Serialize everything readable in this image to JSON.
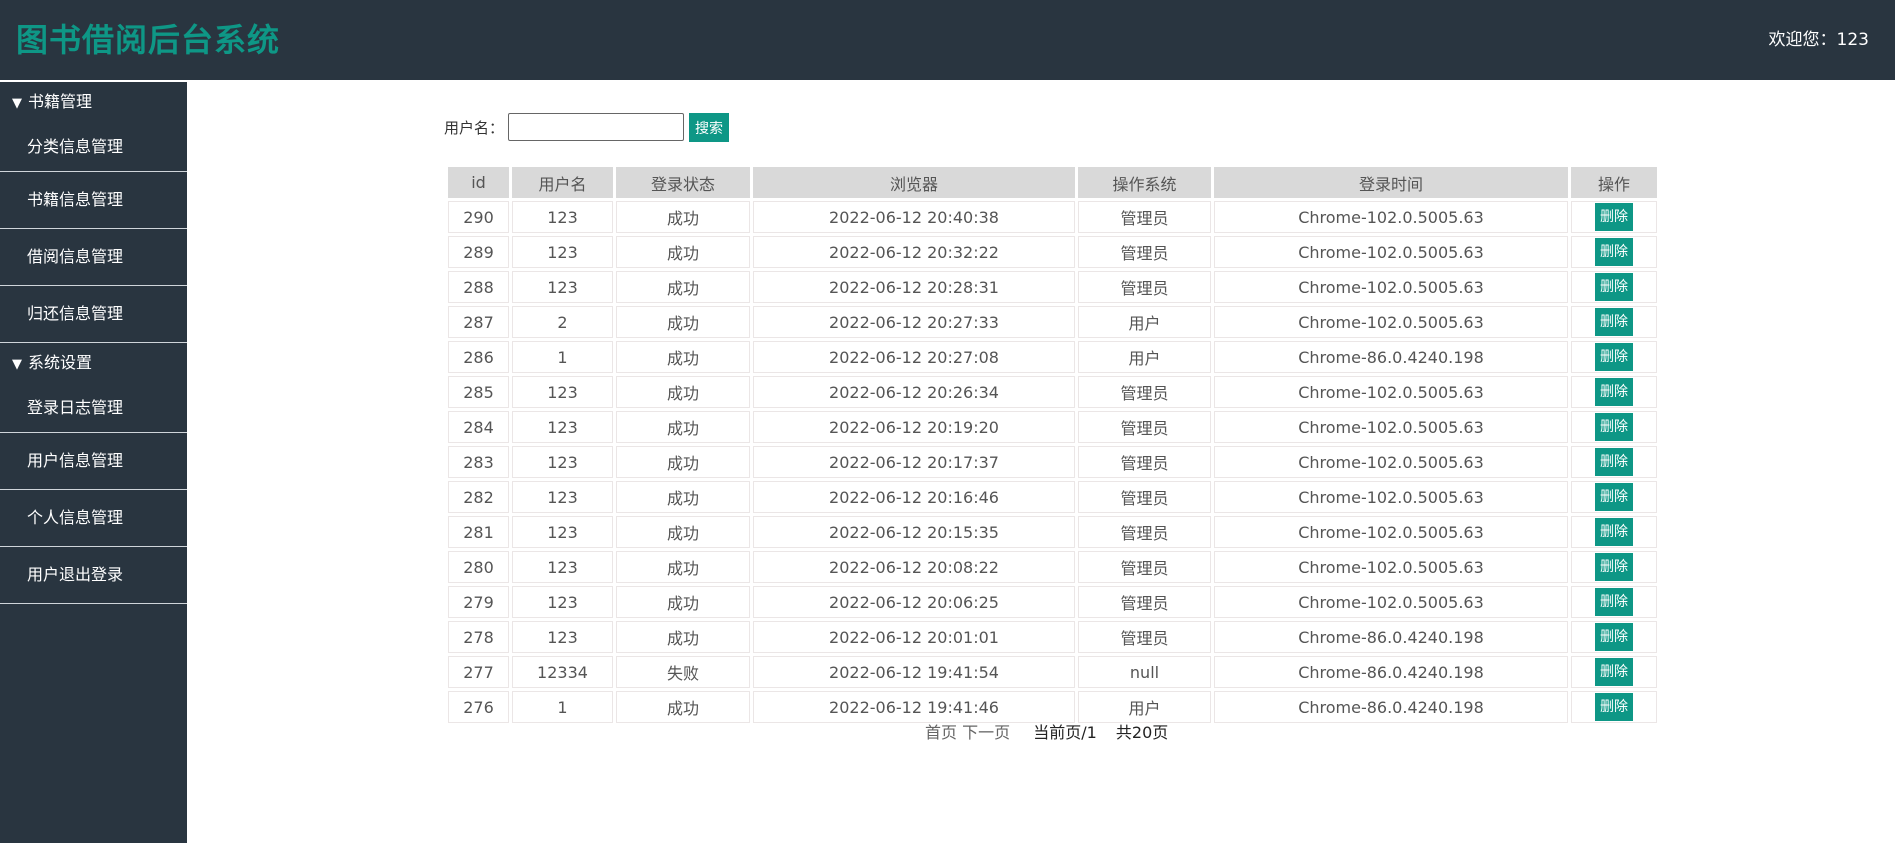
{
  "header": {
    "title": "图书借阅后台系统",
    "welcome": "欢迎您：123"
  },
  "sidebar": {
    "groups": [
      {
        "label": "书籍管理",
        "items": [
          "分类信息管理",
          "书籍信息管理",
          "借阅信息管理",
          "归还信息管理"
        ]
      },
      {
        "label": "系统设置",
        "items": [
          "登录日志管理",
          "用户信息管理",
          "个人信息管理",
          "用户退出登录"
        ]
      }
    ]
  },
  "search": {
    "label": "用户名：",
    "value": "",
    "button": "搜索"
  },
  "table": {
    "headers": [
      "id",
      "用户名",
      "登录状态",
      "浏览器",
      "操作系统",
      "登录时间",
      "操作"
    ],
    "action_label": "删除",
    "rows": [
      [
        "290",
        "123",
        "成功",
        "2022-06-12 20:40:38",
        "管理员",
        "Chrome-102.0.5005.63"
      ],
      [
        "289",
        "123",
        "成功",
        "2022-06-12 20:32:22",
        "管理员",
        "Chrome-102.0.5005.63"
      ],
      [
        "288",
        "123",
        "成功",
        "2022-06-12 20:28:31",
        "管理员",
        "Chrome-102.0.5005.63"
      ],
      [
        "287",
        "2",
        "成功",
        "2022-06-12 20:27:33",
        "用户",
        "Chrome-102.0.5005.63"
      ],
      [
        "286",
        "1",
        "成功",
        "2022-06-12 20:27:08",
        "用户",
        "Chrome-86.0.4240.198"
      ],
      [
        "285",
        "123",
        "成功",
        "2022-06-12 20:26:34",
        "管理员",
        "Chrome-102.0.5005.63"
      ],
      [
        "284",
        "123",
        "成功",
        "2022-06-12 20:19:20",
        "管理员",
        "Chrome-102.0.5005.63"
      ],
      [
        "283",
        "123",
        "成功",
        "2022-06-12 20:17:37",
        "管理员",
        "Chrome-102.0.5005.63"
      ],
      [
        "282",
        "123",
        "成功",
        "2022-06-12 20:16:46",
        "管理员",
        "Chrome-102.0.5005.63"
      ],
      [
        "281",
        "123",
        "成功",
        "2022-06-12 20:15:35",
        "管理员",
        "Chrome-102.0.5005.63"
      ],
      [
        "280",
        "123",
        "成功",
        "2022-06-12 20:08:22",
        "管理员",
        "Chrome-102.0.5005.63"
      ],
      [
        "279",
        "123",
        "成功",
        "2022-06-12 20:06:25",
        "管理员",
        "Chrome-102.0.5005.63"
      ],
      [
        "278",
        "123",
        "成功",
        "2022-06-12 20:01:01",
        "管理员",
        "Chrome-86.0.4240.198"
      ],
      [
        "277",
        "12334",
        "失败",
        "2022-06-12 19:41:54",
        "null",
        "Chrome-86.0.4240.198"
      ],
      [
        "276",
        "1",
        "成功",
        "2022-06-12 19:41:46",
        "用户",
        "Chrome-86.0.4240.198"
      ]
    ]
  },
  "pager": {
    "first": "首页",
    "next": "下一页",
    "current": "当前页/1",
    "total": "共20页"
  },
  "colors": {
    "header_bg": "#293540",
    "accent": "#0e9786"
  }
}
